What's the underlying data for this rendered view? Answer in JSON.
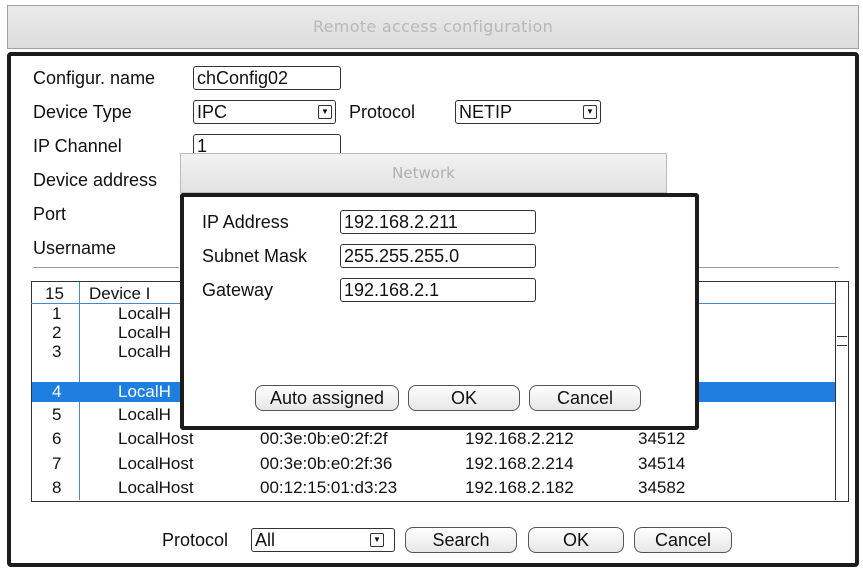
{
  "window": {
    "title": "Remote access configuration"
  },
  "form": {
    "config_name_label": "Configur. name",
    "config_name_value": "chConfig02",
    "device_type_label": "Device Type",
    "device_type_value": "IPC",
    "protocol_label": "Protocol",
    "protocol_value": "NETIP",
    "ip_channel_label": "IP Channel",
    "ip_channel_value": "1",
    "device_address_label": "Device address",
    "port_label": "Port",
    "username_label": "Username"
  },
  "device_list": {
    "header_index": "15",
    "header_device": "Device I",
    "rows": [
      {
        "idx": "1",
        "name": "LocalH",
        "mac": "",
        "ip": "",
        "port": ""
      },
      {
        "idx": "2",
        "name": "LocalH",
        "mac": "",
        "ip": "",
        "port": ""
      },
      {
        "idx": "3",
        "name": "LocalH",
        "mac": "",
        "ip": "",
        "port": ""
      },
      {
        "idx": "4",
        "name": "LocalH",
        "mac": "",
        "ip": "",
        "port": ""
      },
      {
        "idx": "5",
        "name": "LocalH",
        "mac": "",
        "ip": "",
        "port": ""
      },
      {
        "idx": "6",
        "name": "LocalHost",
        "mac": "00:3e:0b:e0:2f:2f",
        "ip": "192.168.2.212",
        "port": "34512"
      },
      {
        "idx": "7",
        "name": "LocalHost",
        "mac": "00:3e:0b:e0:2f:36",
        "ip": "192.168.2.214",
        "port": "34514"
      },
      {
        "idx": "8",
        "name": "LocalHost",
        "mac": "00:12:15:01:d3:23",
        "ip": "192.168.2.182",
        "port": "34582"
      }
    ],
    "selected_index": "4"
  },
  "footer": {
    "protocol_label": "Protocol",
    "protocol_value": "All",
    "search_label": "Search",
    "ok_label": "OK",
    "cancel_label": "Cancel"
  },
  "network_dialog": {
    "title": "Network",
    "ip_label": "IP Address",
    "ip_value": "192.168.2.211",
    "mask_label": "Subnet Mask",
    "mask_value": "255.255.255.0",
    "gateway_label": "Gateway",
    "gateway_value": "192.168.2.1",
    "auto_label": "Auto assigned",
    "ok_label": "OK",
    "cancel_label": "Cancel"
  },
  "colors": {
    "selection": "#1f7fe0",
    "list_line": "#4a86c8",
    "frame": "#1c1c1c"
  },
  "icons": {
    "dropdown": "triangle-down-icon",
    "scroll_thumb": "scroll-grip-icon"
  }
}
